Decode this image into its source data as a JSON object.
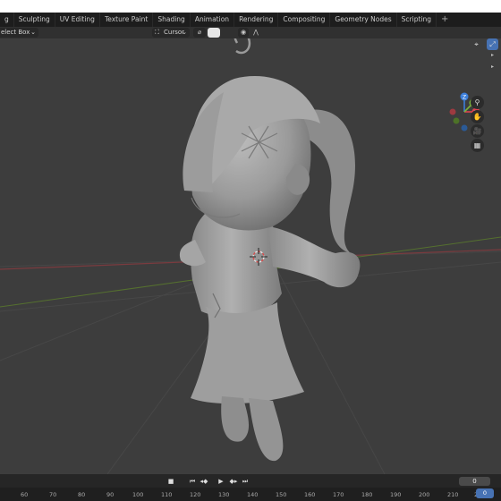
{
  "workspace_tabs": [
    "g",
    "Sculpting",
    "UV Editing",
    "Texture Paint",
    "Shading",
    "Animation",
    "Rendering",
    "Compositing",
    "Geometry Nodes",
    "Scripting"
  ],
  "add_tab": "+",
  "header": {
    "select_box_label": "elect Box",
    "select_chevron": "⌄",
    "pivot_label": "Cursor",
    "pivot_icon": "⛶",
    "snap_icon": "⌀",
    "proportional_icon": "◉",
    "falloff_icon": "⋀"
  },
  "gizmo": {
    "z_label": "Z",
    "y_label": "Y",
    "x_label": "X"
  },
  "nav_buttons": {
    "zoom": "⚲",
    "pan": "✋",
    "camera": "🎥",
    "ortho": "▦"
  },
  "right_edge": {
    "view_toggle": "⤢",
    "tool_toggle": "⌖",
    "arrow1": "▸",
    "arrow2": "▸"
  },
  "playback": [
    "■",
    "⏮",
    "◂◆",
    "▶",
    "◆▸",
    "⏭"
  ],
  "current_frame_field": "0",
  "ruler_ticks": [
    "60",
    "70",
    "80",
    "90",
    "100",
    "110",
    "120",
    "130",
    "140",
    "150",
    "160",
    "170",
    "180",
    "190",
    "200",
    "210",
    "220"
  ],
  "current_frame_marker": "0",
  "colors": {
    "axis_x": "#e0434f",
    "axis_y": "#7bb33a",
    "axis_z": "#3d7fd9",
    "neg_z": "#2b5a96",
    "accent": "#4772b3"
  }
}
